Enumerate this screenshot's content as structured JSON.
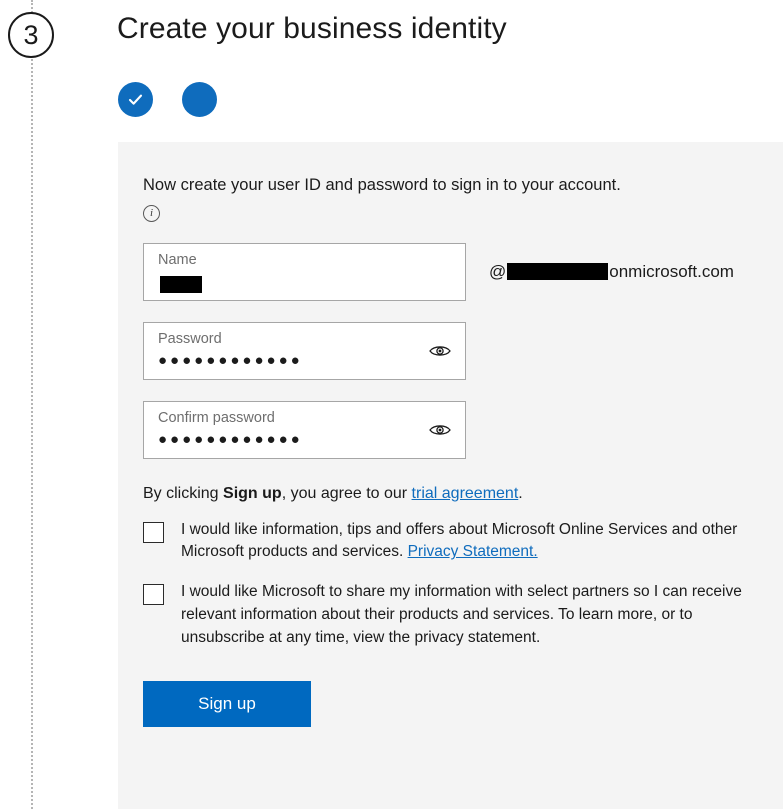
{
  "step": {
    "number": "3"
  },
  "header": {
    "title": "Create your business identity"
  },
  "progress": {
    "dots": [
      {
        "name": "completed-step-dot",
        "state": "completed",
        "icon": "check-icon"
      },
      {
        "name": "current-step-dot",
        "state": "current",
        "icon": "filled-circle-icon"
      }
    ],
    "accent_color": "#0f6cbd"
  },
  "panel": {
    "background_color": "#f4f4f4",
    "intro_text": "Now create your user ID and password to sign in to your account.",
    "info_icon": "info-icon",
    "info_icon_glyph": "i",
    "fields": {
      "name": {
        "label": "Name",
        "value": "",
        "redacted": true,
        "domain_prefix": "@",
        "domain_redacted": true,
        "domain_suffix": "onmicrosoft.com"
      },
      "password": {
        "label": "Password",
        "value": "●●●●●●●●●●●●",
        "reveal_icon": "eye-icon"
      },
      "confirm_password": {
        "label": "Confirm password",
        "value": "●●●●●●●●●●●●",
        "reveal_icon": "eye-icon"
      }
    },
    "legal": {
      "prefix": "By clicking ",
      "bold": "Sign up",
      "middle": ", you agree to our ",
      "link": "trial agreement",
      "suffix": "."
    },
    "checkboxes": [
      {
        "checked": false,
        "text_before_link": "I would like information, tips and offers about Microsoft Online Services and other Microsoft products and services. ",
        "link": "Privacy Statement.",
        "text_after_link": ""
      },
      {
        "checked": false,
        "text_before_link": "I would like Microsoft to share my information with select partners so I can receive relevant information about their products and services. To learn more, or to unsubscribe at any time, view the privacy statement.",
        "link": "",
        "text_after_link": ""
      }
    ],
    "submit": {
      "label": "Sign up",
      "color": "#0069c0"
    }
  }
}
